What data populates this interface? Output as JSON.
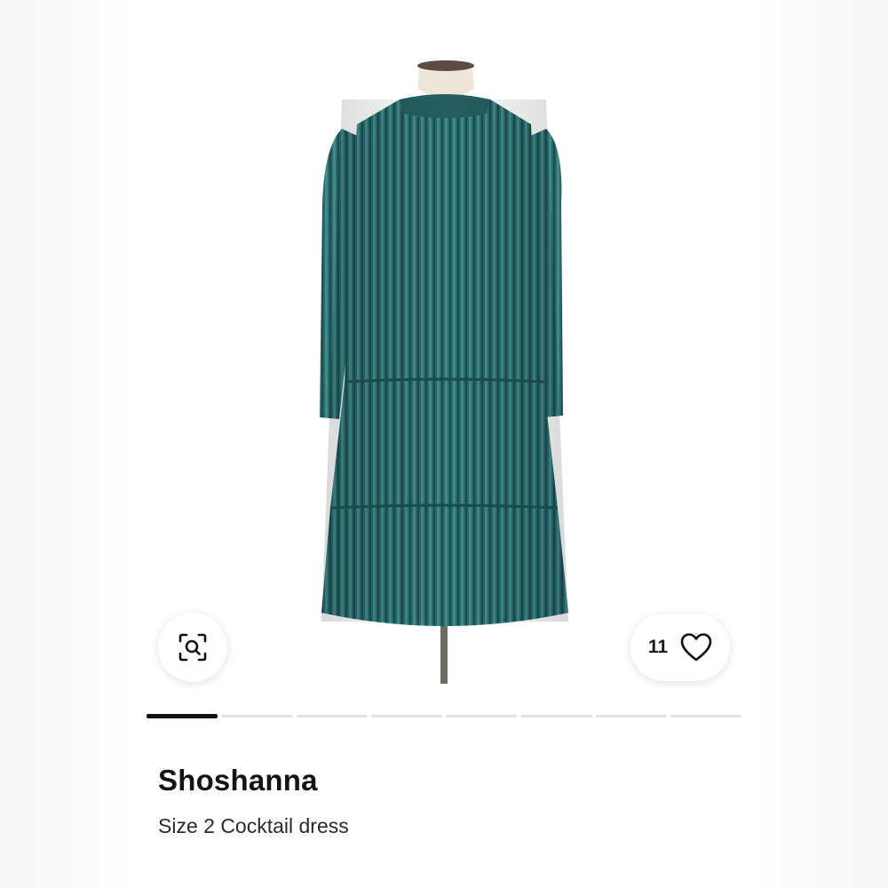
{
  "product": {
    "brand": "Shoshanna",
    "description": "Size 2 Cocktail dress",
    "image_icon": "dress-photo",
    "dress_color": "#2c6b6e"
  },
  "actions": {
    "zoom_icon": "visual-search-icon",
    "like_icon": "heart-icon",
    "like_count": "11"
  },
  "gallery": {
    "total_images": 8,
    "active_index": 0
  }
}
